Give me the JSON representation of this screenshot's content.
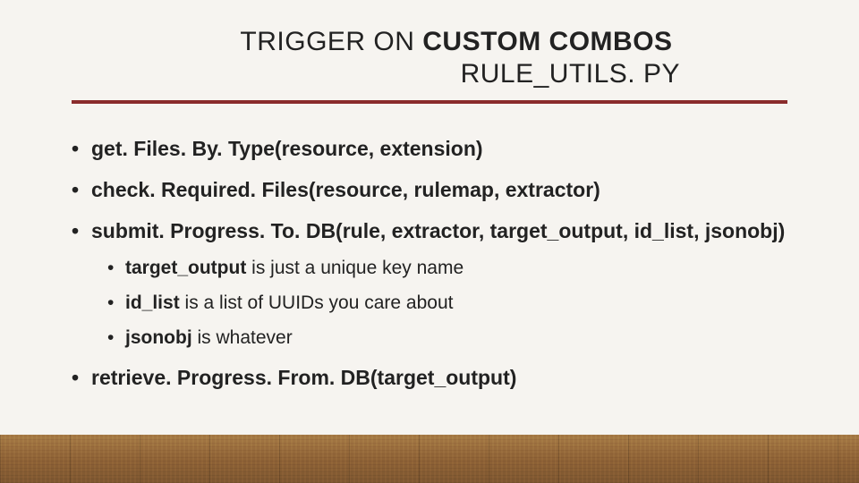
{
  "title": {
    "line1_prefix": "TRIGGER ON ",
    "line1_bold": "CUSTOM COMBOS",
    "line2": "RULE_UTILS. PY"
  },
  "bullets": [
    {
      "text": "get. Files. By. Type(resource, extension)"
    },
    {
      "text": "check. Required. Files(resource, rulemap, extractor)"
    },
    {
      "text": "submit. Progress. To. DB(rule, extractor, target_output, id_list, jsonobj)",
      "sub": [
        {
          "term": "target_output",
          "rest": " is just a unique key name"
        },
        {
          "term": "id_list",
          "rest": " is a list of UUIDs you care about"
        },
        {
          "term": "jsonobj",
          "rest": " is whatever"
        }
      ]
    },
    {
      "text": "retrieve. Progress. From. DB(target_output)"
    }
  ]
}
